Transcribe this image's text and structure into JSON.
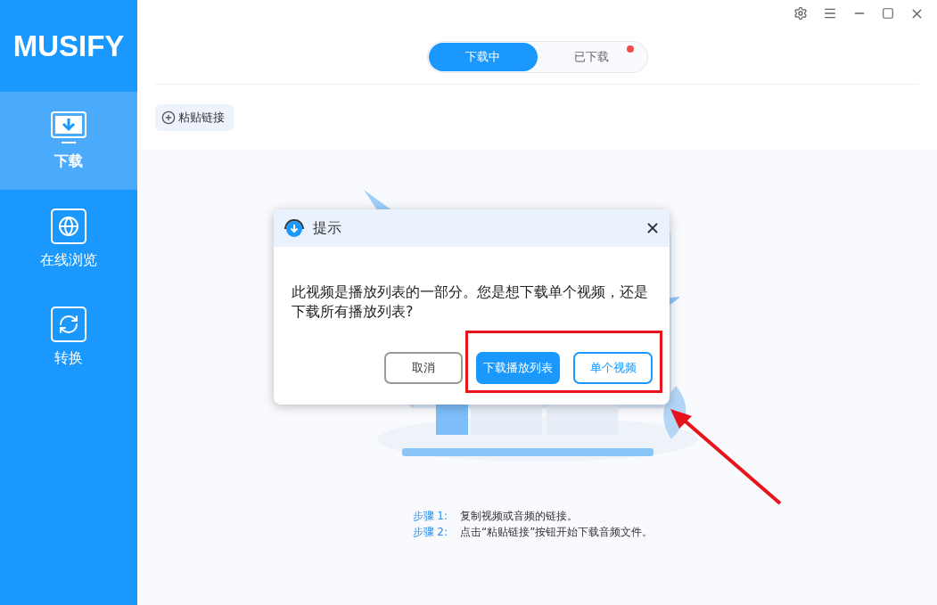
{
  "app": {
    "logo": "MUSIFY"
  },
  "sidebar": {
    "items": [
      {
        "kind": "download",
        "label": "下载",
        "selected": true
      },
      {
        "kind": "browse",
        "label": "在线浏览",
        "selected": false
      },
      {
        "kind": "convert",
        "label": "转换",
        "selected": false
      }
    ]
  },
  "tabs": [
    {
      "label": "下载中",
      "selected": true,
      "badge": false
    },
    {
      "label": "已下载",
      "selected": false,
      "badge": true
    }
  ],
  "toolbar": {
    "paste_button": "粘贴链接"
  },
  "steps": [
    {
      "label": "步骤 1:",
      "text": "复制视频或音频的链接。"
    },
    {
      "label": "步骤 2:",
      "text": "点击“粘贴链接”按钮开始下载音频文件。"
    }
  ],
  "dialog": {
    "title": "提示",
    "message": "此视频是播放列表的一部分。您是想下载单个视频，还是下载所有播放列表?",
    "buttons": [
      {
        "kind": "secondary",
        "label": "取消"
      },
      {
        "kind": "primary",
        "label": "下载播放列表"
      },
      {
        "kind": "outline",
        "label": "单个视频"
      }
    ]
  }
}
